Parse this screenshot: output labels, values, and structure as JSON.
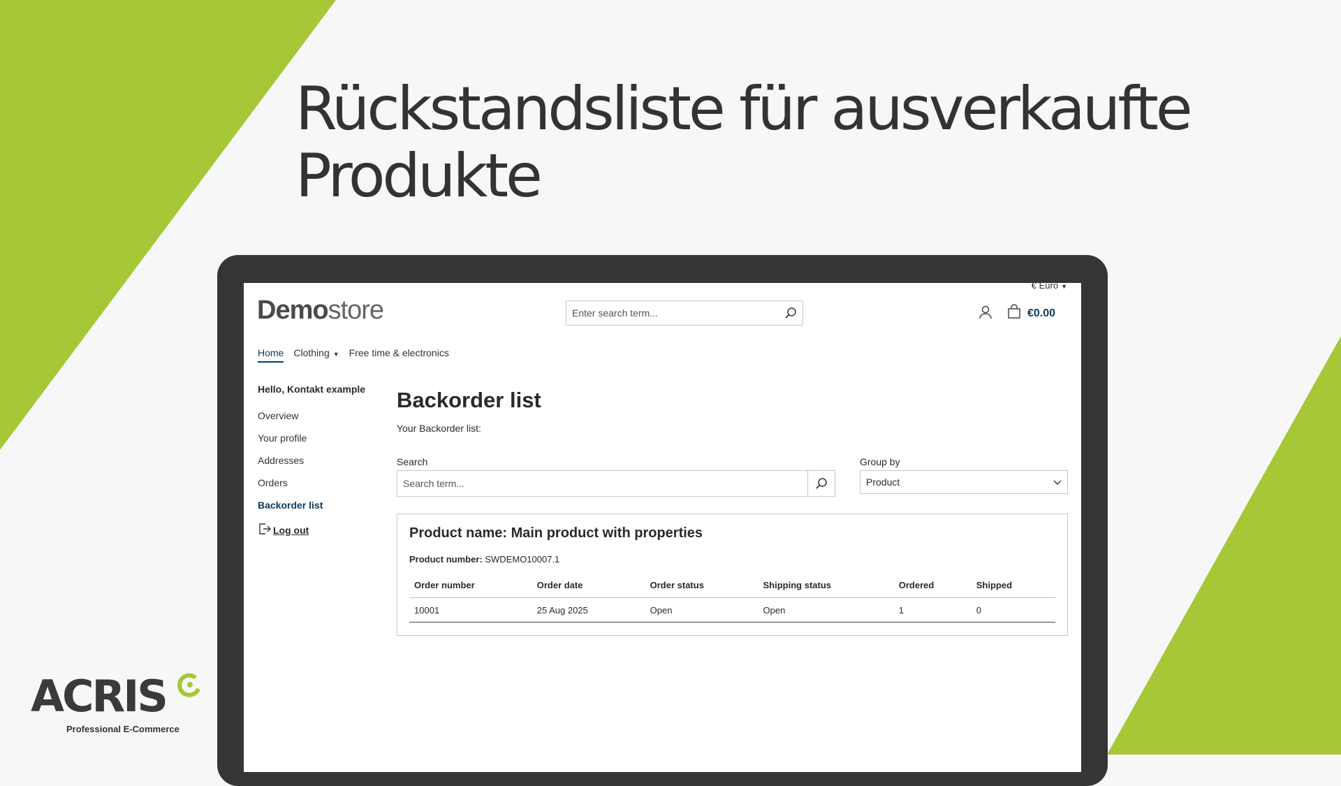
{
  "headline": {
    "line1": "Rückstandsliste für ausverkaufte",
    "line2": "Produkte"
  },
  "colors": {
    "accent_green": "#a6c736",
    "brand_blue": "#0b3b63",
    "frame_dark": "#353535"
  },
  "store": {
    "currency": "€ Euro",
    "logo_bold": "Demo",
    "logo_light": "store",
    "search_placeholder": "Enter search term...",
    "cart_total": "€0.00",
    "icons": {
      "search": "search-icon",
      "account": "user-icon",
      "cart": "cart-icon"
    }
  },
  "nav": {
    "home": "Home",
    "clothing": "Clothing",
    "free_time": "Free time & electronics"
  },
  "sidebar": {
    "greeting": "Hello, Kontakt example",
    "items": [
      "Overview",
      "Your profile",
      "Addresses",
      "Orders",
      "Backorder list"
    ],
    "logout": "Log out"
  },
  "main": {
    "title": "Backorder list",
    "subtitle": "Your Backorder list:",
    "search_label": "Search",
    "search_placeholder": "Search term...",
    "groupby_label": "Group by",
    "groupby_value": "Product"
  },
  "card": {
    "product_name": "Product name: Main product with properties",
    "product_number_label": "Product number:",
    "product_number": "SWDEMO10007.1",
    "columns": [
      "Order number",
      "Order date",
      "Order status",
      "Shipping status",
      "Ordered",
      "Shipped"
    ],
    "rows": [
      [
        "10001",
        "25 Aug 2025",
        "Open",
        "Open",
        "1",
        "0"
      ]
    ]
  },
  "brand": {
    "name": "ACRIS",
    "tagline": "Professional E-Commerce"
  }
}
